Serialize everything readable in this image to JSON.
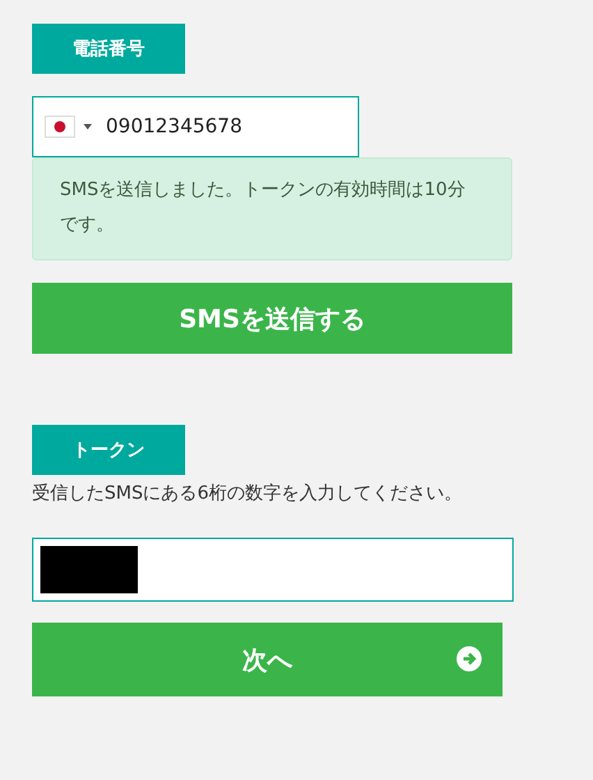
{
  "phone_section": {
    "label": "電話番号",
    "phone_value": "09012345678",
    "notice": "SMSを送信しました。トークンの有効時間は10分です。",
    "send_button": "SMSを送信する"
  },
  "token_section": {
    "label": "トークン",
    "instruction": "受信したSMSにある6桁の数字を入力してください。",
    "token_redacted": true,
    "next_button": "次へ"
  }
}
